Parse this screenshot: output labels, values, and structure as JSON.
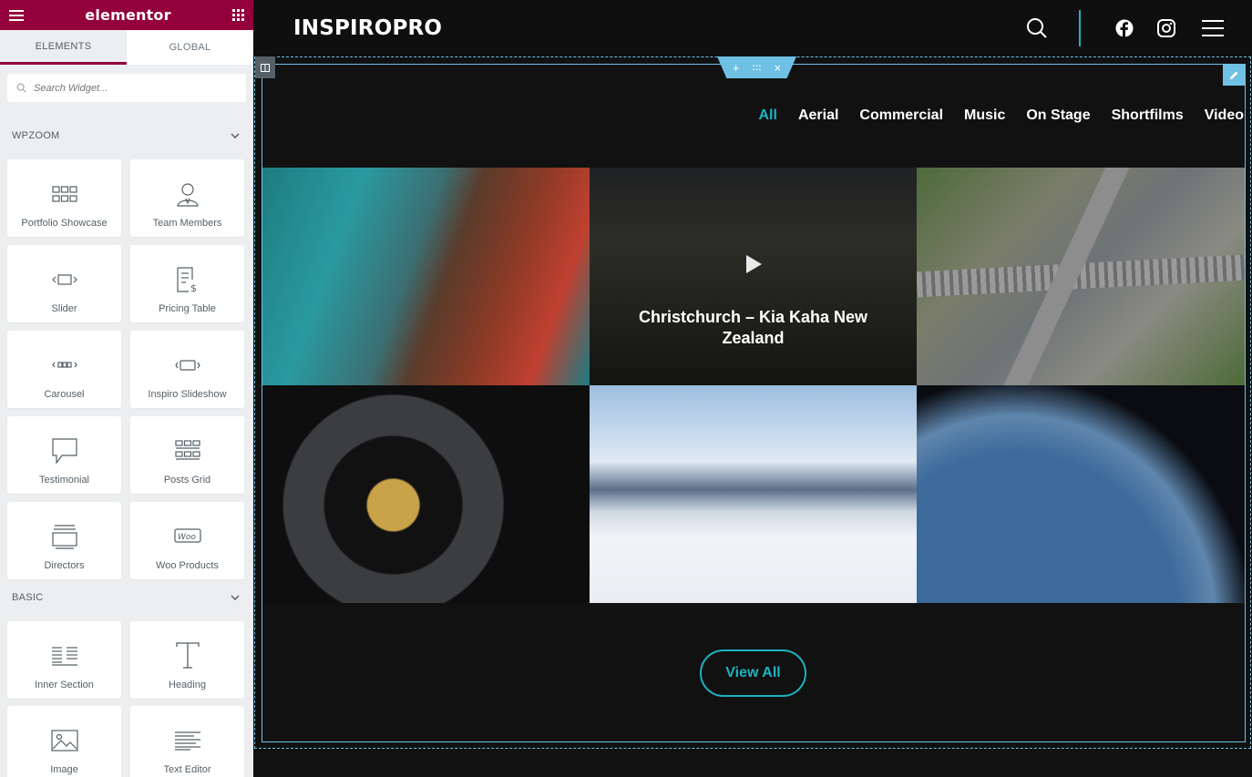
{
  "editor": {
    "logo": "elementor",
    "tabs": [
      {
        "label": "ELEMENTS",
        "active": true
      },
      {
        "label": "GLOBAL",
        "active": false
      }
    ],
    "search_placeholder": "Search Widget...",
    "categories": [
      {
        "title": "WPZOOM",
        "widgets": [
          {
            "label": "Portfolio Showcase",
            "icon": "portfolio-grid-icon"
          },
          {
            "label": "Team Members",
            "icon": "team-member-icon"
          },
          {
            "label": "Slider",
            "icon": "slider-icon"
          },
          {
            "label": "Pricing Table",
            "icon": "pricing-table-icon"
          },
          {
            "label": "Carousel",
            "icon": "carousel-icon"
          },
          {
            "label": "Inspiro Slideshow",
            "icon": "slideshow-icon"
          },
          {
            "label": "Testimonial",
            "icon": "speech-bubble-icon"
          },
          {
            "label": "Posts Grid",
            "icon": "posts-grid-icon"
          },
          {
            "label": "Directors",
            "icon": "directors-icon"
          },
          {
            "label": "Woo Products",
            "icon": "woo-icon"
          }
        ]
      },
      {
        "title": "BASIC",
        "widgets": [
          {
            "label": "Inner Section",
            "icon": "inner-section-icon"
          },
          {
            "label": "Heading",
            "icon": "heading-icon"
          },
          {
            "label": "Image",
            "icon": "image-icon"
          },
          {
            "label": "Text Editor",
            "icon": "text-editor-icon"
          }
        ]
      }
    ],
    "accent_color": "#93003c"
  },
  "site": {
    "brand": "INSPIROPRO",
    "filters": [
      "All",
      "Aerial",
      "Commercial",
      "Music",
      "On Stage",
      "Shortfilms",
      "Video"
    ],
    "active_filter": "All",
    "video_title": "Christchurch – Kia Kaha New Zealand",
    "view_all": "View All",
    "accent_color": "#1cb3c2",
    "tool_plus": "+",
    "tool_move": ":::",
    "tool_close": "×"
  }
}
